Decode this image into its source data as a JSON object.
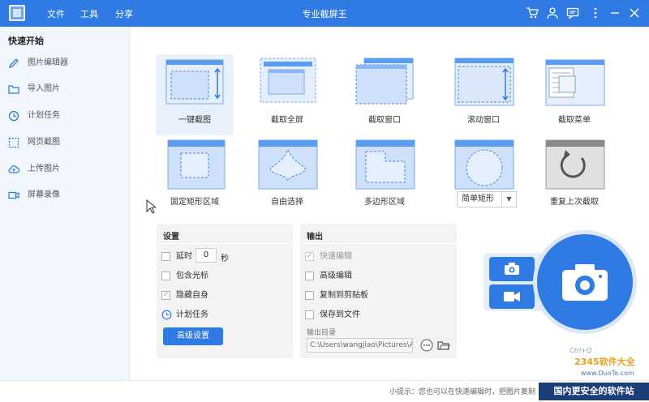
{
  "window": {
    "title": "专业截屏王"
  },
  "menu": [
    "文件",
    "工具",
    "分享"
  ],
  "sidebar": {
    "heading": "快速开始",
    "items": [
      {
        "label": "图片编辑器",
        "icon": "pencil-icon"
      },
      {
        "label": "导入图片",
        "icon": "folder-icon"
      },
      {
        "label": "计划任务",
        "icon": "clock-icon"
      },
      {
        "label": "网页截图",
        "icon": "webpage-icon"
      },
      {
        "label": "上传图片",
        "icon": "cloud-upload-icon"
      },
      {
        "label": "屏幕录像",
        "icon": "video-icon"
      }
    ]
  },
  "modes": [
    {
      "label": "一键截图",
      "icon": "one-click-capture-icon"
    },
    {
      "label": "截取全屏",
      "icon": "fullscreen-capture-icon"
    },
    {
      "label": "截取窗口",
      "icon": "window-capture-icon"
    },
    {
      "label": "滚动窗口",
      "icon": "scroll-window-icon"
    },
    {
      "label": "截取菜单",
      "icon": "menu-capture-icon"
    },
    {
      "label": "固定矩形区域",
      "icon": "fixed-rect-icon"
    },
    {
      "label": "自由选择",
      "icon": "freehand-icon"
    },
    {
      "label": "多边形区域",
      "icon": "polygon-icon"
    },
    {
      "label": "重复上次截取",
      "icon": "repeat-icon"
    }
  ],
  "shape_select": {
    "value": "简单矩形"
  },
  "settings": {
    "heading": "设置",
    "delay_label": "延时",
    "delay_value": "0",
    "delay_unit": "秒",
    "include_cursor": "包含光标",
    "hide_self": "隐藏自身",
    "schedule": "计划任务",
    "advanced_button": "高级设置"
  },
  "output": {
    "heading": "输出",
    "quick_edit": "快速编辑",
    "advanced_edit": "高级编辑",
    "copy_clipboard": "复制到剪贴板",
    "save_file": "保存到文件",
    "dir_label": "输出目录",
    "dir_value": "C:\\Users\\wangjiao\\Pictures\\A"
  },
  "status": {
    "tip": "小提示：您也可以在快速编辑时，把图片复制"
  },
  "watermark": {
    "brand": "2345软件大全",
    "site": "www.DuoTe.com",
    "slogan": "国内更安全的软件站",
    "hotkey": "Ctrl+Q"
  },
  "colors": {
    "accent": "#2f7be3",
    "sidebar": "#f2f7fe",
    "check": "#e38a2a"
  }
}
